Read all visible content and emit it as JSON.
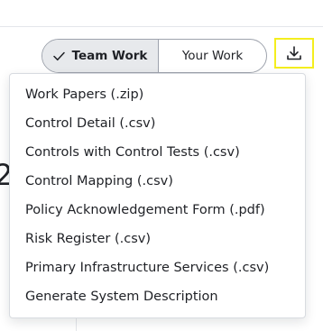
{
  "toggle": {
    "team_work_label": "Team Work",
    "your_work_label": "Your Work",
    "selected": "Team Work"
  },
  "background": {
    "partial_digit": "2"
  },
  "download": {
    "icon": "download-icon",
    "highlight_color": "#f4ee1e"
  },
  "menu": {
    "items": [
      {
        "label": "Work Papers (.zip)"
      },
      {
        "label": "Control Detail (.csv)"
      },
      {
        "label": "Controls with Control Tests (.csv)"
      },
      {
        "label": "Control Mapping (.csv)"
      },
      {
        "label": "Policy Acknowledgement Form (.pdf)"
      },
      {
        "label": "Risk Register (.csv)"
      },
      {
        "label": "Primary Infrastructure Services (.csv)"
      },
      {
        "label": "Generate System Description"
      }
    ]
  }
}
